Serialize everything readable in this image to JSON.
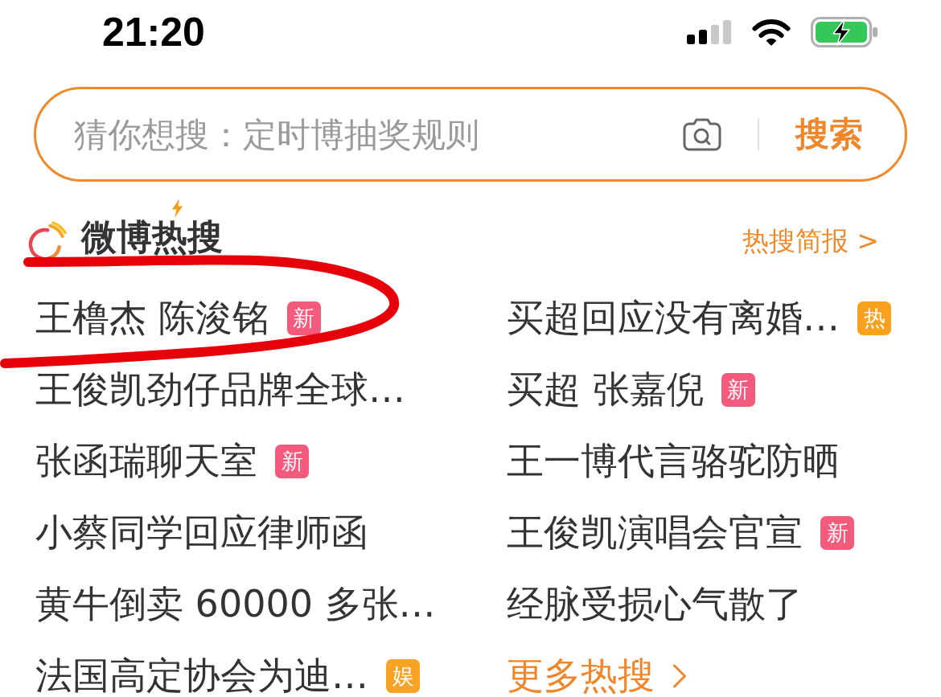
{
  "status_bar": {
    "time": "21:20"
  },
  "search": {
    "placeholder": "猜你想搜：定时博抽奖规则",
    "button": "搜索"
  },
  "hot_search": {
    "title": "微博热搜",
    "briefing_link": "热搜简报 >",
    "items": [
      {
        "text": "王橹杰 陈浚铭",
        "badge": {
          "label": "新",
          "color": "#f45a7c"
        }
      },
      {
        "text": "买超回应没有离婚…",
        "badge": {
          "label": "热",
          "color": "#f7a11f"
        }
      },
      {
        "text": "王俊凯劲仔品牌全球…"
      },
      {
        "text": "买超 张嘉倪",
        "badge": {
          "label": "新",
          "color": "#f45a7c"
        }
      },
      {
        "text": "张函瑞聊天室",
        "badge": {
          "label": "新",
          "color": "#f45a7c"
        }
      },
      {
        "text": "王一博代言骆驼防晒"
      },
      {
        "text": "小蔡同学回应律师函"
      },
      {
        "text": "王俊凯演唱会官宣",
        "badge": {
          "label": "新",
          "color": "#f45a7c"
        }
      },
      {
        "text": "黄牛倒卖 60000 多张…"
      },
      {
        "text": "经脉受损心气散了"
      },
      {
        "text": "法国高定协会为迪…",
        "badge": {
          "label": "娱",
          "color": "#f7a325"
        }
      }
    ],
    "more_link": "更多热搜"
  }
}
